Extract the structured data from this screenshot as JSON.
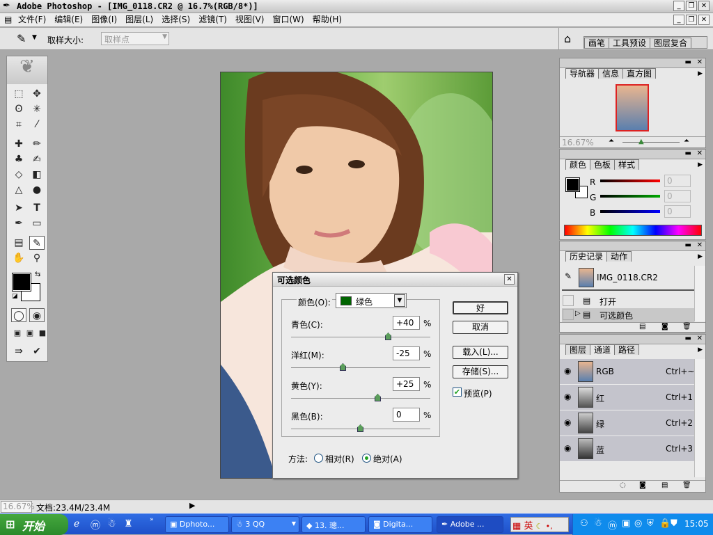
{
  "window": {
    "title": "Adobe Photoshop - [IMG_0118.CR2 @ 16.7%(RGB/8*)]"
  },
  "menu": [
    "文件(F)",
    "编辑(E)",
    "图像(I)",
    "图层(L)",
    "选择(S)",
    "滤镜(T)",
    "视图(V)",
    "窗口(W)",
    "帮助(H)"
  ],
  "options": {
    "sample_label": "取样大小:",
    "sample_value": "取样点",
    "palette_tabs": [
      "画笔",
      "工具预设",
      "图层复合"
    ]
  },
  "dialog": {
    "title": "可选颜色",
    "color_label": "颜色(O):",
    "color_value": "绿色",
    "color_swatch": "#006400",
    "rows": [
      {
        "label": "青色(C):",
        "value": "+40",
        "unit": "%",
        "level": 0.7
      },
      {
        "label": "洋红(M):",
        "value": "-25",
        "unit": "%",
        "level": 0.375
      },
      {
        "label": "黄色(Y):",
        "value": "+25",
        "unit": "%",
        "level": 0.625
      },
      {
        "label": "黑色(B):",
        "value": "0",
        "unit": "%",
        "level": 0.5
      }
    ],
    "buttons": {
      "ok": "好",
      "cancel": "取消",
      "load": "载入(L)...",
      "save": "存储(S)..."
    },
    "preview_label": "预览(P)",
    "preview_checked": true,
    "method_label": "方法:",
    "method_relative": "相对(R)",
    "method_absolute": "绝对(A)"
  },
  "navigator": {
    "tabs": [
      "导航器",
      "信息",
      "直方图"
    ],
    "zoom": "16.67%"
  },
  "color_panel": {
    "tabs": [
      "颜色",
      "色板",
      "样式"
    ],
    "r_label": "R",
    "g_label": "G",
    "b_label": "B",
    "r_value": "0",
    "g_value": "0",
    "b_value": "0"
  },
  "history": {
    "tabs": [
      "历史记录",
      "动作"
    ],
    "snapshot": "IMG_0118.CR2",
    "items": [
      "打开",
      "可选颜色"
    ]
  },
  "layers": {
    "tabs": [
      "图层",
      "通道",
      "路径"
    ],
    "channels": [
      {
        "name": "RGB",
        "shortcut": "Ctrl+~"
      },
      {
        "name": "红",
        "shortcut": "Ctrl+1"
      },
      {
        "name": "绿",
        "shortcut": "Ctrl+2"
      },
      {
        "name": "蓝",
        "shortcut": "Ctrl+3"
      }
    ]
  },
  "status": {
    "zoom": "16.67%",
    "doc": "文档:23.4M/23.4M"
  },
  "taskbar": {
    "start": "开始",
    "tasks": [
      "Dphoto...",
      "3 QQ",
      "13. 璁...",
      "Digita...",
      "Adobe ..."
    ],
    "ime": "英",
    "clock": "15:05"
  }
}
